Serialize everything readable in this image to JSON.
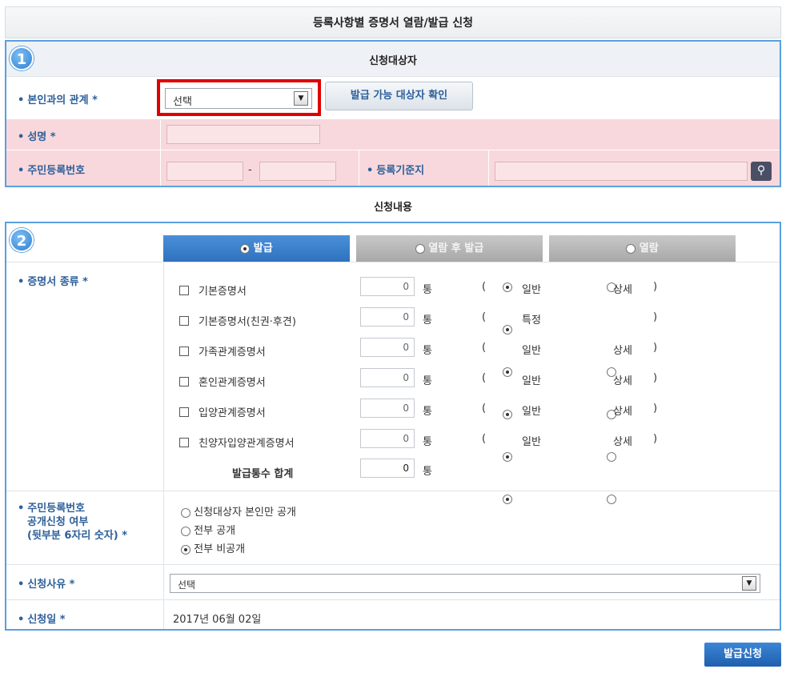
{
  "page_title": "등록사항별 증명서 열람/발급 신청",
  "section1": {
    "step": "1",
    "heading": "신청대상자",
    "relation_label": "본인과의 관계 *",
    "relation_select": "선택",
    "check_button": "발급 가능 대상자 확인",
    "name_label": "성명 *",
    "rrn_label": "주민등록번호",
    "rrn_separator": "-",
    "base_addr_label": "등록기준지"
  },
  "section2": {
    "step": "2",
    "heading": "신청내용",
    "tabs": [
      {
        "label": "발급",
        "active": true
      },
      {
        "label": "열람 후 발급",
        "active": false
      },
      {
        "label": "열람",
        "active": false
      }
    ],
    "cert_type_label": "증명서 종류 *",
    "unit": "통",
    "paren_open": "(",
    "paren_close": ")",
    "certs": [
      {
        "name": "기본증명서",
        "count": "0",
        "opt1": "일반",
        "opt2": "상세"
      },
      {
        "name": "기본증명서(친권·후견)",
        "count": "0",
        "opt1": "특정",
        "opt2": ""
      },
      {
        "name": "가족관계증명서",
        "count": "0",
        "opt1": "일반",
        "opt2": "상세"
      },
      {
        "name": "혼인관계증명서",
        "count": "0",
        "opt1": "일반",
        "opt2": "상세"
      },
      {
        "name": "입양관계증명서",
        "count": "0",
        "opt1": "일반",
        "opt2": "상세"
      },
      {
        "name": "친양자입양관계증명서",
        "count": "0",
        "opt1": "일반",
        "opt2": "상세"
      }
    ],
    "total_label": "발급통수 합계",
    "total_count": "0",
    "disclosure_label_1": "주민등록번호",
    "disclosure_label_2": "공개신청 여부",
    "disclosure_label_3": "(뒷부분 6자리 숫자) *",
    "disclosure_options": [
      {
        "label": "신청대상자 본인만 공개",
        "selected": false
      },
      {
        "label": "전부 공개",
        "selected": false
      },
      {
        "label": "전부 비공개",
        "selected": true
      }
    ],
    "reason_label": "신청사유 *",
    "reason_select": "선택",
    "date_label": "신청일 *",
    "date_value": "2017년 06월 02일"
  },
  "submit_button": "발급신청",
  "colors": {
    "accent_blue": "#2f72bf",
    "border_blue": "#5aa0df",
    "pink_row": "#f8d8dc",
    "highlight_red": "#e00000"
  }
}
